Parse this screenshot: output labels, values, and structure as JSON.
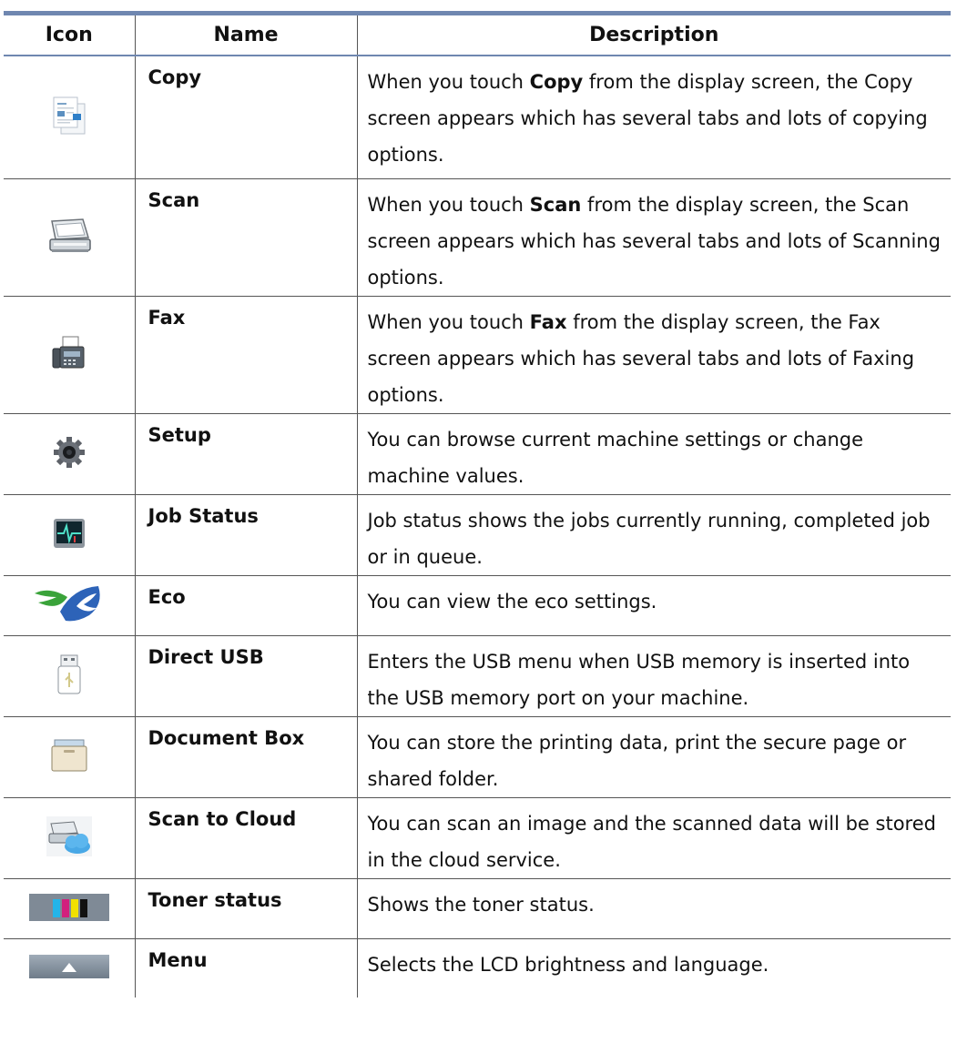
{
  "headers": {
    "icon": "Icon",
    "name": "Name",
    "description": "Description"
  },
  "rows": [
    {
      "icon": "copy-icon",
      "name": "Copy",
      "desc_pre": "When you touch ",
      "desc_bold": "Copy",
      "desc_post": " from the display screen, the Copy screen appears which has several tabs and lots of copying options."
    },
    {
      "icon": "scanner-icon",
      "name": "Scan",
      "desc_pre": " When you touch ",
      "desc_bold": "Scan",
      "desc_post": " from the display screen, the Scan screen appears which has several tabs and lots of Scanning options."
    },
    {
      "icon": "fax-machine-icon",
      "name": "Fax",
      "desc_pre": "When you touch ",
      "desc_bold": "Fax",
      "desc_post": " from the display screen, the Fax screen appears which has several tabs and lots of Faxing options."
    },
    {
      "icon": "gear-icon",
      "name": "Setup",
      "desc_pre": "You can browse current machine settings or change machine values.",
      "desc_bold": "",
      "desc_post": ""
    },
    {
      "icon": "monitor-pulse-icon",
      "name": "Job Status",
      "desc_pre": "Job status shows the jobs currently running, completed job or in queue.",
      "desc_bold": "",
      "desc_post": ""
    },
    {
      "icon": "eco-leaf-icon",
      "name": "Eco",
      "desc_pre": "You can view the eco settings.",
      "desc_bold": "",
      "desc_post": ""
    },
    {
      "icon": "usb-drive-icon",
      "name": "Direct USB",
      "desc_pre": "Enters the USB menu when USB memory is inserted into the USB memory port on your machine.",
      "desc_bold": "",
      "desc_post": ""
    },
    {
      "icon": "document-box-icon",
      "name": "Document Box",
      "desc_pre": "You can store the printing data, print the secure page or shared folder.",
      "desc_bold": "",
      "desc_post": ""
    },
    {
      "icon": "scan-to-cloud-icon",
      "name": "Scan to Cloud",
      "desc_pre": "You can scan an image and the scanned data will be stored in the cloud service.",
      "desc_bold": "",
      "desc_post": ""
    },
    {
      "icon": "toner-cartridges-icon",
      "name": "Toner status",
      "desc_pre": "Shows the toner status.",
      "desc_bold": "",
      "desc_post": ""
    },
    {
      "icon": "menu-up-arrow-icon",
      "name": "Menu",
      "desc_pre": "Selects the LCD brightness and language.",
      "desc_bold": "",
      "desc_post": ""
    }
  ]
}
